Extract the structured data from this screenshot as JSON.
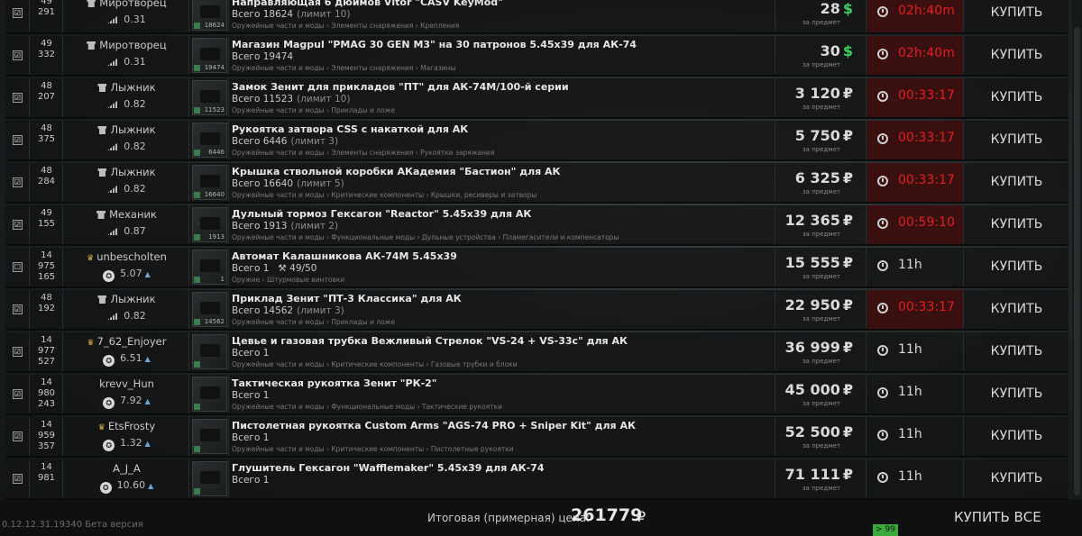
{
  "rows": [
    {
      "checked": "☑",
      "lvl": [
        "49",
        "291"
      ],
      "seller_icon": "trader",
      "seller": "Миротворец",
      "rep": "0.31",
      "rep_type": "bars",
      "count": "18624",
      "title": "Направляющая 6 дюймов Vltor \"CASV KeyMod\"",
      "total": "Всего 18624",
      "limit": "(лимит 10)",
      "dur": "",
      "cat": "Оружейные части и моды › Элементы снаряжения › Крепления",
      "price": "28",
      "cur": "$",
      "cur_type": "usd",
      "per": "за предмет",
      "time": "02h:40m",
      "time_red": true,
      "buy": "КУПИТЬ"
    },
    {
      "checked": "☑",
      "lvl": [
        "49",
        "332"
      ],
      "seller_icon": "trader",
      "seller": "Миротворец",
      "rep": "0.31",
      "rep_type": "bars",
      "count": "19474",
      "title": "Магазин Magpul \"PMAG 30 GEN M3\" на 30 патронов 5.45x39 для АК-74",
      "total": "Всего 19474",
      "limit": "",
      "dur": "",
      "cat": "Оружейные части и моды › Элементы снаряжения › Магазины",
      "price": "30",
      "cur": "$",
      "cur_type": "usd",
      "per": "за предмет",
      "time": "02h:40m",
      "time_red": true,
      "buy": "КУПИТЬ"
    },
    {
      "checked": "☑",
      "lvl": [
        "48",
        "207"
      ],
      "seller_icon": "trader",
      "seller": "Лыжник",
      "rep": "0.82",
      "rep_type": "bars",
      "count": "11523",
      "title": "Замок Зенит для прикладов \"ПТ\" для АК-74М/100-й серии",
      "total": "Всего 11523",
      "limit": "(лимит 10)",
      "dur": "",
      "cat": "Оружейные части и моды › Приклады и ложе",
      "price": "3 120",
      "cur": "₽",
      "cur_type": "rub",
      "per": "за предмет",
      "time": "00:33:17",
      "time_red": true,
      "buy": "КУПИТЬ"
    },
    {
      "checked": "☑",
      "lvl": [
        "48",
        "375"
      ],
      "seller_icon": "trader",
      "seller": "Лыжник",
      "rep": "0.82",
      "rep_type": "bars",
      "count": "6446",
      "title": "Рукоятка затвора CSS с накаткой для АК",
      "total": "Всего 6446",
      "limit": "(лимит 3)",
      "dur": "",
      "cat": "Оружейные части и моды › Элементы снаряжения › Рукоятки заряжания",
      "price": "5 750",
      "cur": "₽",
      "cur_type": "rub",
      "per": "за предмет",
      "time": "00:33:17",
      "time_red": true,
      "buy": "КУПИТЬ"
    },
    {
      "checked": "☑",
      "lvl": [
        "48",
        "284"
      ],
      "seller_icon": "trader",
      "seller": "Лыжник",
      "rep": "0.82",
      "rep_type": "bars",
      "count": "16640",
      "title": "Крышка ствольной коробки АКадемия \"Бастион\" для АК",
      "total": "Всего 16640",
      "limit": "(лимит 5)",
      "dur": "",
      "cat": "Оружейные части и моды › Критические компоненты › Крышки, ресиверы и затворы",
      "price": "6 325",
      "cur": "₽",
      "cur_type": "rub",
      "per": "за предмет",
      "time": "00:33:17",
      "time_red": true,
      "buy": "КУПИТЬ"
    },
    {
      "checked": "☑",
      "lvl": [
        "49",
        "155"
      ],
      "seller_icon": "trader",
      "seller": "Механик",
      "rep": "0.87",
      "rep_type": "bars",
      "count": "1913",
      "title": "Дульный тормоз Гексагон \"Reactor\" 5.45x39 для АК",
      "total": "Всего 1913",
      "limit": "(лимит 2)",
      "dur": "",
      "cat": "Оружейные части и моды › Функциональные моды › Дульные устройства › Пламегасители и компенсаторы",
      "price": "12 365",
      "cur": "₽",
      "cur_type": "rub",
      "per": "за предмет",
      "time": "00:59:10",
      "time_red": true,
      "buy": "КУПИТЬ"
    },
    {
      "checked": "☐",
      "lvl": [
        "14",
        "975",
        "165"
      ],
      "seller_icon": "crown",
      "seller": "unbescholten",
      "rep": "5.07",
      "rep_type": "medal",
      "count": "1",
      "title": "Автомат Калашникова АК-74М 5.45x39",
      "total": "Всего 1",
      "limit": "",
      "dur": "⚒ 49/50",
      "cat": "Оружие › Штурмовые винтовки",
      "price": "15 555",
      "cur": "₽",
      "cur_type": "rub",
      "per": "за предмет",
      "time": "11h",
      "time_red": false,
      "buy": "КУПИТЬ"
    },
    {
      "checked": "☑",
      "lvl": [
        "48",
        "192"
      ],
      "seller_icon": "trader",
      "seller": "Лыжник",
      "rep": "0.82",
      "rep_type": "bars",
      "count": "14562",
      "title": "Приклад Зенит \"ПТ-3 Классика\" для АК",
      "total": "Всего 14562",
      "limit": "(лимит 3)",
      "dur": "",
      "cat": "Оружейные части и моды › Приклады и ложе",
      "price": "22 950",
      "cur": "₽",
      "cur_type": "rub",
      "per": "за предмет",
      "time": "00:33:17",
      "time_red": true,
      "buy": "КУПИТЬ"
    },
    {
      "checked": "☑",
      "lvl": [
        "14",
        "977",
        "527"
      ],
      "seller_icon": "crown",
      "seller": "7_62_Enjoyer",
      "rep": "6.51",
      "rep_type": "medal",
      "count": "",
      "title": "Цевье и газовая трубка Вежливый Стрелок \"VS-24 + VS-33c\" для АК",
      "total": "Всего 1",
      "limit": "",
      "dur": "",
      "cat": "Оружейные части и моды › Критические компоненты › Газовые трубки и блоки",
      "price": "36 999",
      "cur": "₽",
      "cur_type": "rub",
      "per": "за предмет",
      "time": "11h",
      "time_red": false,
      "buy": "КУПИТЬ"
    },
    {
      "checked": "☑",
      "lvl": [
        "14",
        "980",
        "243"
      ],
      "seller_icon": "none",
      "seller": "krevv_Hun",
      "rep": "7.92",
      "rep_type": "medal",
      "count": "",
      "title": "Тактическая рукоятка Зенит \"РК-2\"",
      "total": "Всего 1",
      "limit": "",
      "dur": "",
      "cat": "Оружейные части и моды › Функциональные моды › Тактические рукоятки",
      "price": "45 000",
      "cur": "₽",
      "cur_type": "rub",
      "per": "за предмет",
      "time": "11h",
      "time_red": false,
      "buy": "КУПИТЬ"
    },
    {
      "checked": "☑",
      "lvl": [
        "14",
        "959",
        "357"
      ],
      "seller_icon": "crown",
      "seller": "EtsFrosty",
      "rep": "1.32",
      "rep_type": "medal",
      "count": "",
      "title": "Пистолетная рукоятка Custom Arms \"AGS-74 PRO + Sniper Kit\" для АК",
      "total": "Всего 1",
      "limit": "",
      "dur": "",
      "cat": "Оружейные части и моды › Критические компоненты › Пистолетные рукоятки",
      "price": "52 500",
      "cur": "₽",
      "cur_type": "rub",
      "per": "за предмет",
      "time": "11h",
      "time_red": false,
      "buy": "КУПИТЬ"
    },
    {
      "checked": "☑",
      "lvl": [
        "14",
        "981",
        ""
      ],
      "seller_icon": "none",
      "seller": "A_J_A",
      "rep": "10.60",
      "rep_type": "medal",
      "count": "",
      "title": "Глушитель Гексагон \"Wafflemaker\" 5.45x39 для АК-74",
      "total": "Всего 1",
      "limit": "",
      "dur": "",
      "cat": "",
      "price": "71 111",
      "cur": "₽",
      "cur_type": "rub",
      "per": "за предмет",
      "time": "11h",
      "time_red": false,
      "buy": "КУПИТЬ"
    }
  ],
  "footer": {
    "version": "0.12.12.31.19340 Бета версия",
    "total_label": "Итоговая (примерная) цена:",
    "total_value": "261779",
    "total_cur": "₽",
    "buy_all": "КУПИТЬ ВСЕ",
    "badge": "> 99"
  },
  "colors": {
    "usd": "#3ccf5b",
    "timer_red": "#e0201e",
    "badge": "#3aaa3c"
  }
}
